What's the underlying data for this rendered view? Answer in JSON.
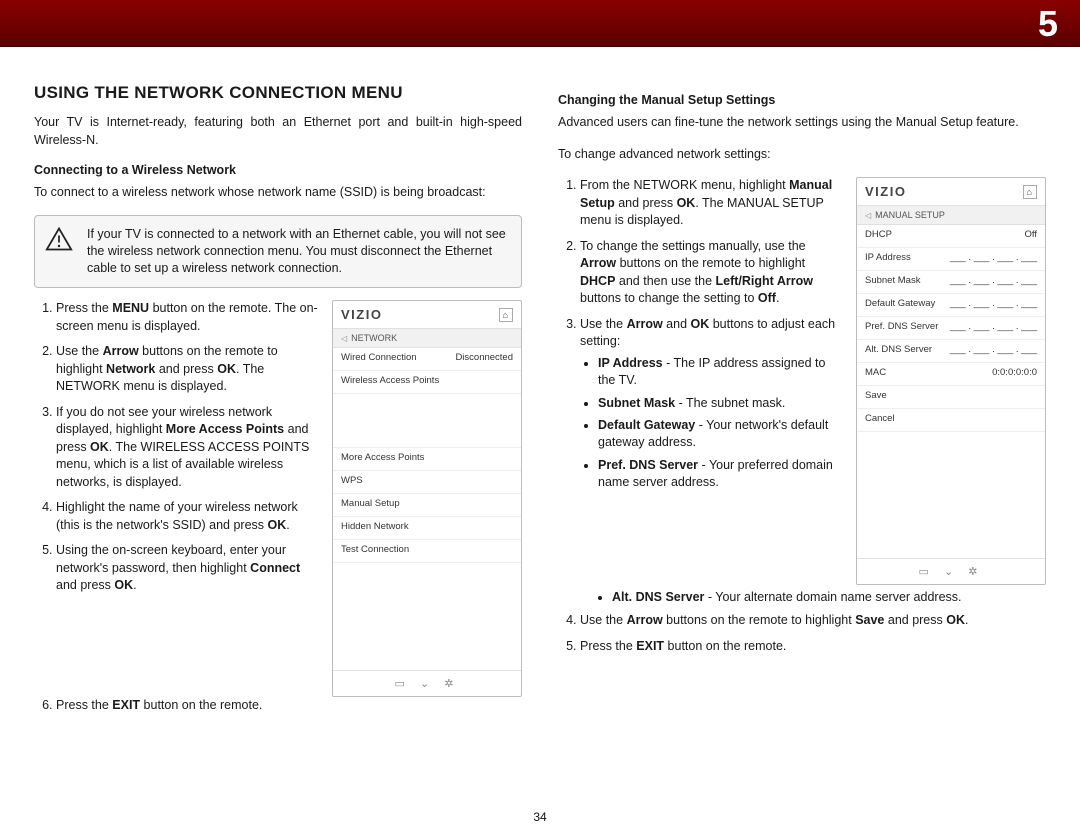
{
  "chapter_num": "5",
  "page_number": "34",
  "left": {
    "h1": "USING THE NETWORK CONNECTION MENU",
    "intro": "Your TV is Internet-ready, featuring both an Ethernet port and built-in high-speed Wireless-N.",
    "sub1": "Connecting to a Wireless Network",
    "sub1_intro": "To connect to a wireless network whose network name (SSID) is being broadcast:",
    "warning": "If your TV is connected to a network with an Ethernet cable, you will not see the wireless network connection menu. You must disconnect the Ethernet cable to set up a wireless network connection.",
    "s1a": "Press the ",
    "s1b": "MENU",
    "s1c": " button on the remote. The on-screen menu is displayed.",
    "s2a": "Use the ",
    "s2b": "Arrow",
    "s2c": " buttons on the remote to highlight ",
    "s2d": "Network",
    "s2e": " and press ",
    "s2f": "OK",
    "s2g": ". The NETWORK menu is displayed.",
    "s3a": "If you do not see your wireless network displayed, highlight ",
    "s3b": "More Access Points",
    "s3c": " and press ",
    "s3d": "OK",
    "s3e": ". The WIRELESS ACCESS POINTS menu, which is a list of available wireless networks, is displayed.",
    "s4a": "Highlight the name of your wireless network (this is the network's SSID) and press ",
    "s4b": "OK",
    "s4c": ".",
    "s5a": "Using the on-screen keyboard, enter your network's password, then highlight ",
    "s5b": "Connect",
    "s5c": " and press ",
    "s5d": "OK",
    "s5e": ".",
    "s6a": "Press the ",
    "s6b": "EXIT",
    "s6c": " button on the remote."
  },
  "tv_net": {
    "brand": "VIZIO",
    "crumb": "NETWORK",
    "rows": {
      "wired_l": "Wired Connection",
      "wired_r": "Disconnected",
      "wap": "Wireless Access Points",
      "more": "More Access Points",
      "wps": "WPS",
      "manual": "Manual Setup",
      "hidden": "Hidden Network",
      "test": "Test Connection"
    }
  },
  "right": {
    "sub": "Changing the Manual Setup Settings",
    "intro": "Advanced users can fine-tune the network settings using the Manual Setup feature.",
    "lead": "To change advanced network settings:",
    "s1a": "From the NETWORK menu, highlight ",
    "s1b": "Manual Setup",
    "s1c": " and press ",
    "s1d": "OK",
    "s1e": ". The MANUAL SETUP menu is displayed.",
    "s2a": "To change the settings manually, use the ",
    "s2b": "Arrow",
    "s2c": " buttons on the remote to highlight ",
    "s2d": "DHCP",
    "s2e": " and then use the ",
    "s2f": "Left/Right Arrow",
    "s2g": " buttons to change the setting to ",
    "s2h": "Off",
    "s2i": ".",
    "s3a": "Use the ",
    "s3b": "Arrow",
    "s3c": " and ",
    "s3d": "OK",
    "s3e": " buttons to adjust each setting:",
    "b_ip_t": "IP Address",
    "b_ip_d": " - The IP address assigned to the TV.",
    "b_sm_t": "Subnet Mask",
    "b_sm_d": " - The subnet mask.",
    "b_dg_t": "Default Gateway",
    "b_dg_d": " - Your network's default gateway address.",
    "b_pd_t": "Pref. DNS Server",
    "b_pd_d": " - Your preferred domain name server address.",
    "b_ad_t": "Alt. DNS Server",
    "b_ad_d": " - Your alternate domain name server address.",
    "s4a": "Use the ",
    "s4b": "Arrow",
    "s4c": " buttons on the remote to highlight ",
    "s4d": "Save",
    "s4e": " and press ",
    "s4f": "OK",
    "s4g": ".",
    "s5a": "Press the ",
    "s5b": "EXIT",
    "s5c": " button on the remote."
  },
  "tv_man": {
    "brand": "VIZIO",
    "crumb": "MANUAL SETUP",
    "dhcp_l": "DHCP",
    "dhcp_r": "Off",
    "ip_l": "IP Address",
    "ip_v": "___ . ___ . ___ . ___",
    "sm_l": "Subnet Mask",
    "sm_v": "___ . ___ . ___ . ___",
    "dg_l": "Default Gateway",
    "dg_v": "___ . ___ . ___ . ___",
    "pd_l": "Pref. DNS Server",
    "pd_v": "___ . ___ . ___ . ___",
    "ad_l": "Alt. DNS Server",
    "ad_v": "___ . ___ . ___ . ___",
    "mac_l": "MAC",
    "mac_v": "0:0:0:0:0:0",
    "save": "Save",
    "cancel": "Cancel"
  }
}
